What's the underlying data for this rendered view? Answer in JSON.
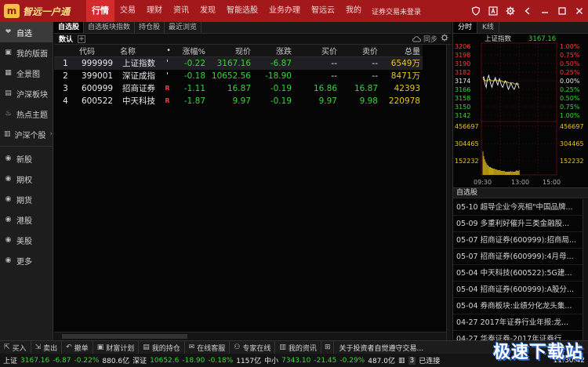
{
  "header": {
    "logo_char": "m",
    "logo_text": "智远一户通",
    "nav": [
      "行情",
      "交易",
      "理财",
      "资讯",
      "发现",
      "智能选股",
      "业务办理",
      "智远云",
      "我的"
    ],
    "active_nav": "行情",
    "login_status": "证券交易未登录",
    "icons": [
      "shield-icon",
      "font-icon",
      "gear-icon",
      "back-icon",
      "minimize-icon",
      "maximize-icon",
      "close-icon"
    ]
  },
  "sidebar": {
    "items": [
      {
        "label": "自选",
        "icon": "heart-icon",
        "active": true
      },
      {
        "label": "我的版面",
        "icon": "layout-icon"
      },
      {
        "label": "全景图",
        "icon": "grid-icon"
      },
      {
        "label": "沪深板块",
        "icon": "board-icon"
      },
      {
        "label": "热点主题",
        "icon": "fire-icon"
      },
      {
        "label": "沪深个股",
        "icon": "stock-icon",
        "arrow": true
      },
      {
        "label": "新股",
        "icon": "new-icon"
      },
      {
        "label": "期权",
        "icon": "option-icon"
      },
      {
        "label": "期货",
        "icon": "futures-icon"
      },
      {
        "label": "港股",
        "icon": "hk-icon"
      },
      {
        "label": "美股",
        "icon": "us-icon"
      },
      {
        "label": "更多",
        "icon": "more-icon"
      }
    ]
  },
  "main": {
    "tabs": [
      "自选股",
      "自选板块指数",
      "持仓股",
      "最近浏览"
    ],
    "active_tab": "自选股",
    "toolbar": {
      "label": "数认",
      "add": "+",
      "sync": "同步"
    },
    "columns": [
      "",
      "代码",
      "名称",
      "•",
      "涨幅%",
      "现价",
      "涨跌",
      "买价",
      "卖价",
      "总量"
    ],
    "rows": [
      {
        "n": "1",
        "code": "999999",
        "name": "上证指数",
        "mark": "'",
        "pct": "-0.22",
        "price": "3167.16",
        "chg": "-6.87",
        "bid": "--",
        "ask": "--",
        "vol": "6549万"
      },
      {
        "n": "2",
        "code": "399001",
        "name": "深证成指",
        "mark": "'",
        "pct": "-0.18",
        "price": "10652.56",
        "chg": "-18.90",
        "bid": "--",
        "ask": "--",
        "vol": "8471万"
      },
      {
        "n": "3",
        "code": "600999",
        "name": "招商证券",
        "mark": "R",
        "pct": "-1.11",
        "price": "16.87",
        "chg": "-0.19",
        "bid": "16.86",
        "ask": "16.87",
        "vol": "42393"
      },
      {
        "n": "4",
        "code": "600522",
        "name": "中天科技",
        "mark": "R",
        "pct": "-1.87",
        "price": "9.97",
        "chg": "-0.19",
        "bid": "9.97",
        "ask": "9.98",
        "vol": "220978"
      }
    ]
  },
  "right": {
    "tabs": [
      "分时",
      "K线"
    ],
    "active_tab": "分时",
    "mini_title": "上证指数",
    "mini_price": "3167.16",
    "price_ticks": [
      "3206",
      "3198",
      "3190",
      "3182",
      "3174",
      "3166",
      "3158",
      "3150",
      "3142"
    ],
    "pct_ticks": [
      "1.00%",
      "0.75%",
      "0.50%",
      "0.25%",
      "0.00%",
      "0.25%",
      "0.50%",
      "0.75%",
      "1.00%"
    ],
    "vol_ticks": [
      "456697",
      "304465",
      "152232"
    ],
    "time_ticks": [
      "09:30",
      "13:00",
      "15:00"
    ],
    "news_header": "自选股",
    "news": [
      "05-10 超导企业今亮相\"中国品牌...",
      "05-09 多重利好催升三类金融股...",
      "05-07 招商证券(600999):招商局...",
      "05-07 招商证券(600999):4月母...",
      "05-04 中天科技(600522):5G建...",
      "05-04 招商证券(600999):A股分...",
      "05-04 券商板块:业绩分化龙头集...",
      "04-27 2017年证券行业年报:龙...",
      "04-27 华泰证券-2017年证券行..."
    ]
  },
  "bottombar": {
    "items": [
      "买入",
      "卖出",
      "撤单",
      "财富计划",
      "我的持仓",
      "在线客服",
      "专家在线",
      "我的资讯"
    ],
    "announcement": "关于投资者自觉遵守交易..."
  },
  "ticker": {
    "sh_label": "上证",
    "sh_price": "3167.16",
    "sh_chg": "-6.87",
    "sh_pct": "-0.22%",
    "sh_amt": "880.6亿",
    "sz_label": "深证",
    "sz_price": "10652.6",
    "sz_chg": "-18.90",
    "sz_pct": "-0.18%",
    "sz_amt": "1157亿",
    "zx_label": "中小",
    "zx_price": "7343.10",
    "zx_chg": "-21.45",
    "zx_pct": "-0.29%",
    "zx_amt": "487.0亿",
    "conn_count": "3",
    "conn_text": "已连接",
    "time": "11:30:42"
  },
  "watermark": "极速下载站"
}
